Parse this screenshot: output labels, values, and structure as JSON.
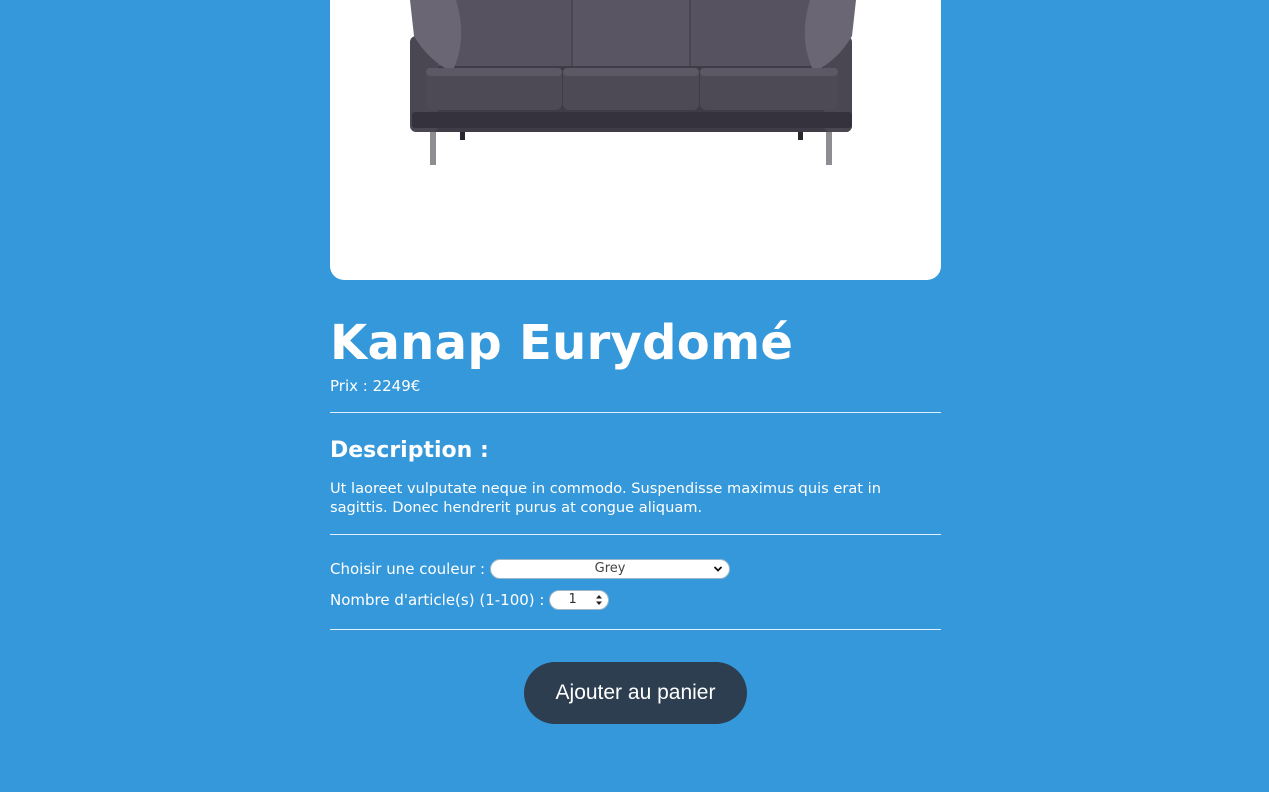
{
  "product": {
    "image_alt": "Photo d'un canapé gris",
    "title": "Kanap Eurydomé",
    "price_label": "Prix : ",
    "price_value": "2249",
    "currency": "€",
    "description_heading": "Description :",
    "description_text": "Ut laoreet vulputate neque in commodo. Suspendisse maximus quis erat in sagittis. Donec hendrerit purus at congue aliquam."
  },
  "options": {
    "color_label": "Choisir une couleur :",
    "color_selected": "Grey",
    "quantity_label": "Nombre d'article(s) (1-100) :",
    "quantity_value": "1"
  },
  "actions": {
    "add_to_cart_label": "Ajouter au panier"
  },
  "colors": {
    "background": "#3498db",
    "card": "#ffffff",
    "button": "#2c3e50",
    "sofa": "#4f4a58"
  },
  "icons": {
    "color_select_chevron": "chevron-down-icon",
    "quantity_spinner": "spinner-arrows-icon"
  }
}
